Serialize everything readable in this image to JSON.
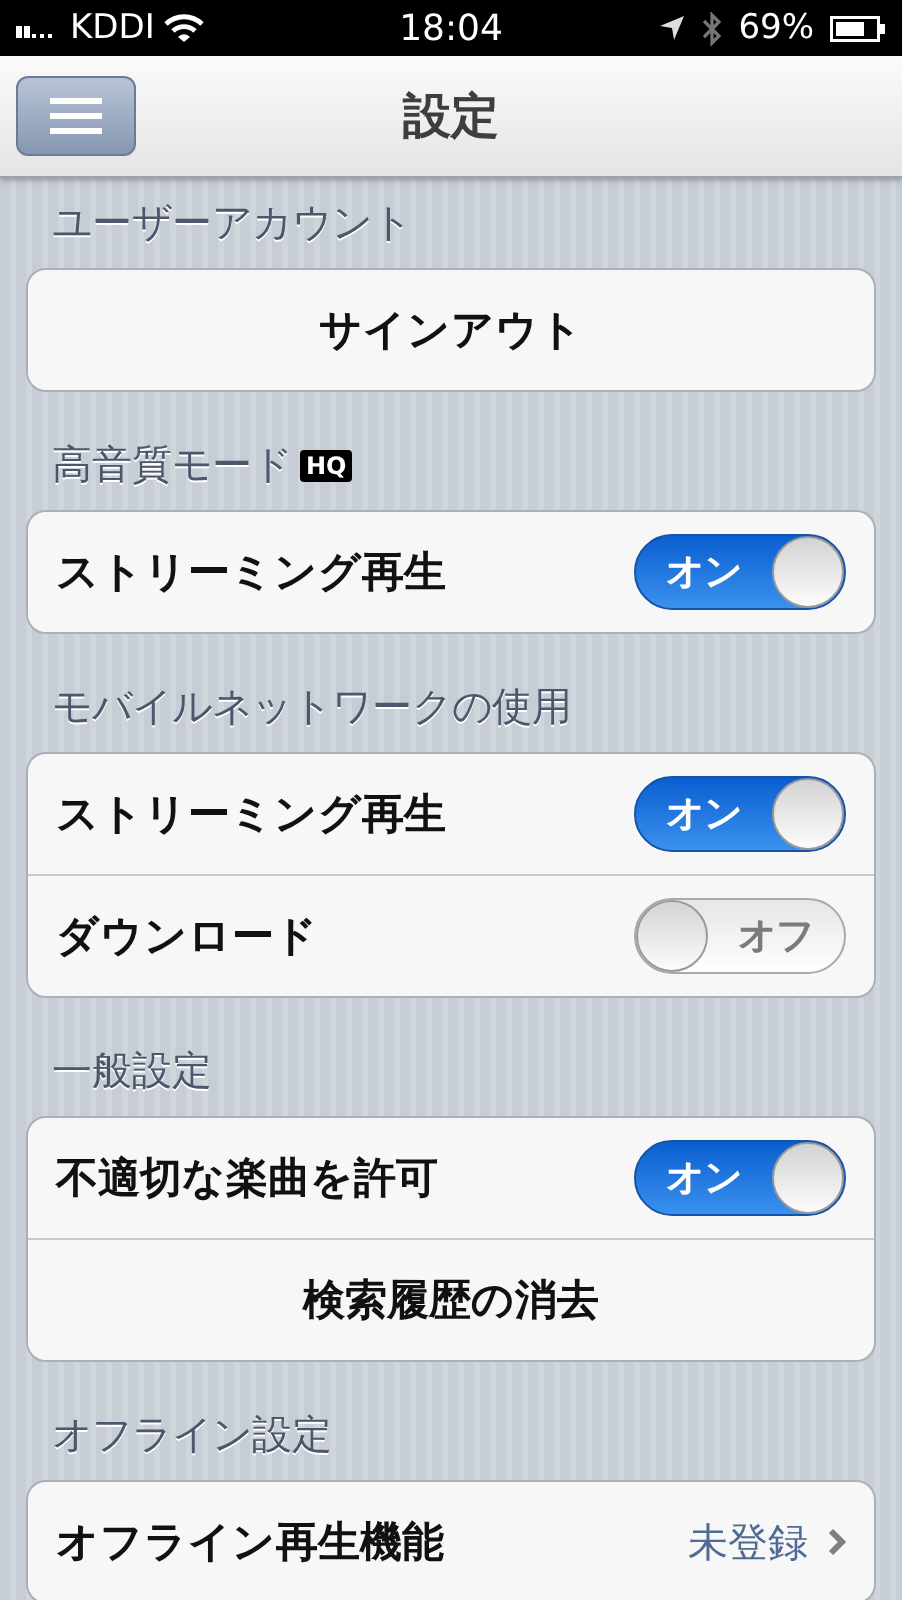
{
  "status_bar": {
    "carrier": "KDDI",
    "time": "18:04",
    "battery": "69%"
  },
  "nav_bar": {
    "title": "設定"
  },
  "sections": [
    {
      "header": "ユーザーアカウント",
      "rows": [
        {
          "kind": "button",
          "label": "サインアウト"
        }
      ]
    },
    {
      "header": "高音質モード",
      "badge": "HQ",
      "rows": [
        {
          "kind": "switch",
          "label": "ストリーミング再生",
          "on": true,
          "switch_text": "オン"
        }
      ]
    },
    {
      "header": "モバイルネットワークの使用",
      "rows": [
        {
          "kind": "switch",
          "label": "ストリーミング再生",
          "on": true,
          "switch_text": "オン"
        },
        {
          "kind": "switch",
          "label": "ダウンロード",
          "on": false,
          "switch_text": "オフ"
        }
      ]
    },
    {
      "header": "一般設定",
      "rows": [
        {
          "kind": "switch",
          "label": "不適切な楽曲を許可",
          "on": true,
          "switch_text": "オン"
        },
        {
          "kind": "button",
          "label": "検索履歴の消去"
        }
      ]
    },
    {
      "header": "オフライン設定",
      "rows": [
        {
          "kind": "link",
          "label": "オフライン再生機能",
          "value": "未登録"
        }
      ]
    }
  ]
}
